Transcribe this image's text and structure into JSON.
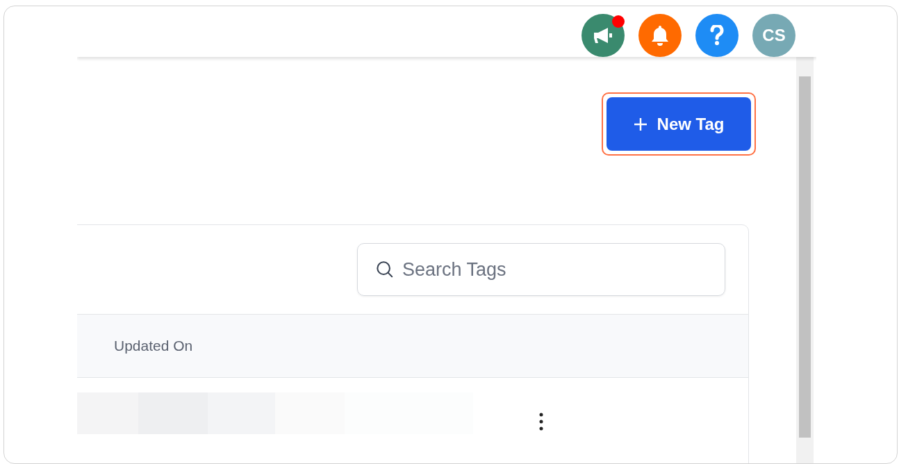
{
  "header": {
    "actions": [
      {
        "kind": "announcements",
        "has_notification": true
      },
      {
        "kind": "notifications",
        "has_notification": false
      },
      {
        "kind": "help",
        "has_notification": false
      },
      {
        "kind": "avatar",
        "initials": "CS",
        "has_notification": false
      }
    ]
  },
  "new_tag_button": {
    "label": "New Tag",
    "highlighted": true
  },
  "search": {
    "placeholder": "Search Tags"
  },
  "table": {
    "columns": [
      "Updated On"
    ],
    "rows": [
      {
        "loading": true
      }
    ]
  }
}
